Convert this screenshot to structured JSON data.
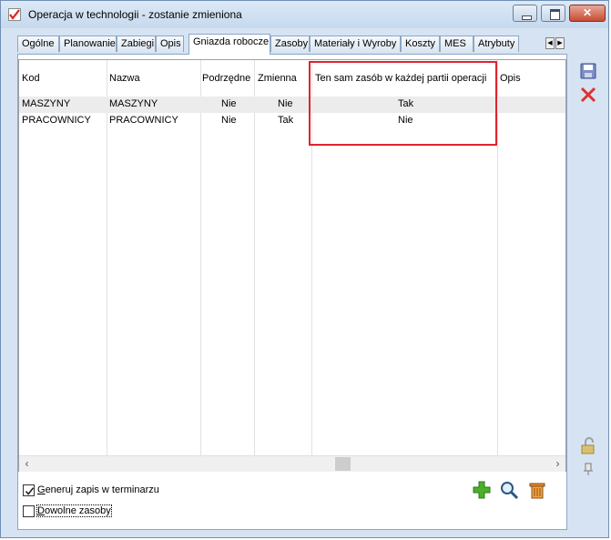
{
  "window": {
    "title": "Operacja w technologii - zostanie zmieniona"
  },
  "tabs": [
    {
      "label": "Ogólne"
    },
    {
      "label": "Planowanie"
    },
    {
      "label": "Zabiegi"
    },
    {
      "label": "Opis"
    },
    {
      "label": "Gniazda robocze",
      "active": true
    },
    {
      "label": "Zasoby"
    },
    {
      "label": "Materiały i Wyroby"
    },
    {
      "label": "Koszty"
    },
    {
      "label": "MES"
    },
    {
      "label": "Atrybuty"
    }
  ],
  "grid": {
    "columns": [
      "Kod",
      "Nazwa",
      "Podrzędne",
      "Zmienna",
      "Ten sam zasób w każdej partii operacji",
      "Opis"
    ],
    "rows": [
      {
        "kod": "MASZYNY",
        "nazwa": "MASZYNY",
        "podrzedne": "Nie",
        "zmienna": "Nie",
        "ten_sam": "Tak",
        "opis": ""
      },
      {
        "kod": "PRACOWNICY",
        "nazwa": "PRACOWNICY",
        "podrzedne": "Nie",
        "zmienna": "Tak",
        "ten_sam": "Nie",
        "opis": ""
      }
    ],
    "highlight_color": "#e0222e"
  },
  "options": {
    "generuj_label": "Generuj zapis w terminarzu",
    "generuj_checked": true,
    "dowolne_label": "Dowolne zasoby",
    "dowolne_checked": false
  },
  "icons": {
    "save": "save-icon",
    "delete": "delete-x-icon",
    "add": "add-plus-icon",
    "search": "magnifier-icon",
    "trash": "trash-icon",
    "lock": "padlock-icon",
    "pin": "pin-icon"
  }
}
